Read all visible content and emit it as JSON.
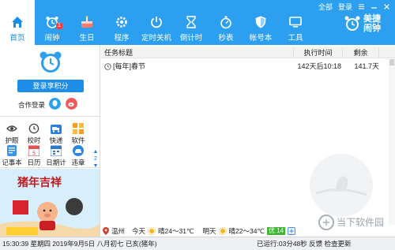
{
  "window": {
    "menu_all": "全部",
    "login": "登录"
  },
  "nav": [
    {
      "label": "首页",
      "icon": "home-icon"
    },
    {
      "label": "闹钟",
      "icon": "alarm-icon",
      "badge": "1"
    },
    {
      "label": "生日",
      "icon": "cake-icon"
    },
    {
      "label": "程序",
      "icon": "gear-icon"
    },
    {
      "label": "定时关机",
      "icon": "power-icon"
    },
    {
      "label": "倒计时",
      "icon": "hourglass-icon"
    },
    {
      "label": "秒表",
      "icon": "stopwatch-icon"
    },
    {
      "label": "帐号本",
      "icon": "shield-icon"
    },
    {
      "label": "工具",
      "icon": "monitor-icon"
    }
  ],
  "brand": {
    "line1": "美捷",
    "line2": "闹钟"
  },
  "left": {
    "login_button": "登录享积分",
    "coop_label": "合作登录",
    "grid": [
      {
        "label": "护眼",
        "icon": "eye-icon"
      },
      {
        "label": "校时",
        "icon": "clock-icon"
      },
      {
        "label": "快递",
        "icon": "truck-icon"
      },
      {
        "label": "软件",
        "icon": "apps-icon"
      },
      {
        "label": "记事本",
        "icon": "notepad-icon"
      },
      {
        "label": "日历",
        "icon": "calendar-icon"
      },
      {
        "label": "日期计",
        "icon": "date-calc-icon"
      },
      {
        "label": "违章",
        "icon": "car-icon"
      }
    ],
    "page_number": "2",
    "banner_text": "猪年吉祥"
  },
  "table": {
    "columns": [
      "任务标题",
      "执行时间",
      "剩余"
    ],
    "rows": [
      {
        "title": "[每年]春节",
        "time": "142天后10:18",
        "remaining": "141.7天"
      }
    ]
  },
  "weather": {
    "city": "温州",
    "today_label": "今天",
    "today_desc": "晴24～31℃",
    "tomorrow_label": "明天",
    "tomorrow_desc": "晴22～34℃",
    "aqi": "优 14"
  },
  "status": {
    "datetime": "15:30:39 星期四 2019年9月5日 八月初七 已亥(猪年)",
    "right": "已运行:03分48秒  反馈  检查更新"
  },
  "watermark": "当下软件园",
  "colors": {
    "accent": "#2c9ff0",
    "button": "#1e8ee8",
    "aqi": "#41b637"
  }
}
